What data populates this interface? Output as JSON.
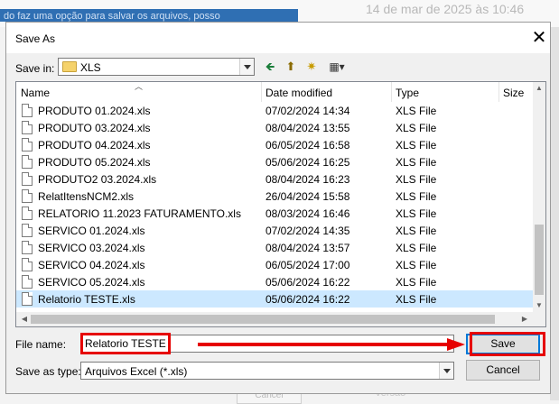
{
  "background": {
    "banner_text": "do faz uma opção para salvar os arquivos, posso",
    "date_text": "14 de mar de 2025 às 10:46",
    "bottom_button": "Cancel",
    "bottom_label": "Versão"
  },
  "dialog": {
    "title": "Save As",
    "close_glyph": "✕",
    "save_in_label": "Save in:",
    "save_in_value": "XLS",
    "toolbar": {
      "back_glyph": "🡸",
      "up_glyph": "⬆",
      "new_folder_glyph": "✷",
      "view_glyph": "▦▾"
    },
    "columns": [
      "Name",
      "Date modified",
      "Type",
      "Size"
    ],
    "files": [
      {
        "name": "PRODUTO 01.2024.xls",
        "date": "07/02/2024 14:34",
        "type": "XLS File"
      },
      {
        "name": "PRODUTO 03.2024.xls",
        "date": "08/04/2024 13:55",
        "type": "XLS File"
      },
      {
        "name": "PRODUTO 04.2024.xls",
        "date": "06/05/2024 16:58",
        "type": "XLS File"
      },
      {
        "name": "PRODUTO 05.2024.xls",
        "date": "05/06/2024 16:25",
        "type": "XLS File"
      },
      {
        "name": "PRODUTO2 03.2024.xls",
        "date": "08/04/2024 16:23",
        "type": "XLS File"
      },
      {
        "name": "RelatItensNCM2.xls",
        "date": "26/04/2024 15:58",
        "type": "XLS File"
      },
      {
        "name": "RELATORIO 11.2023 FATURAMENTO.xls",
        "date": "08/03/2024 16:46",
        "type": "XLS File"
      },
      {
        "name": "SERVICO 01.2024.xls",
        "date": "07/02/2024 14:35",
        "type": "XLS File"
      },
      {
        "name": "SERVICO 03.2024.xls",
        "date": "08/04/2024 13:57",
        "type": "XLS File"
      },
      {
        "name": "SERVICO 04.2024.xls",
        "date": "06/05/2024 17:00",
        "type": "XLS File"
      },
      {
        "name": "SERVICO 05.2024.xls",
        "date": "05/06/2024 16:22",
        "type": "XLS File"
      },
      {
        "name": "Relatorio TESTE.xls",
        "date": "05/06/2024 16:22",
        "type": "XLS File",
        "selected": true
      }
    ],
    "file_name_label": "File name:",
    "file_name_value": "Relatorio TESTE",
    "save_as_type_label": "Save as type:",
    "save_as_type_value": "Arquivos Excel (*.xls)",
    "save_button": "Save",
    "cancel_button": "Cancel"
  },
  "annotation_color": "#e60000",
  "selection_color": "#cce8ff"
}
